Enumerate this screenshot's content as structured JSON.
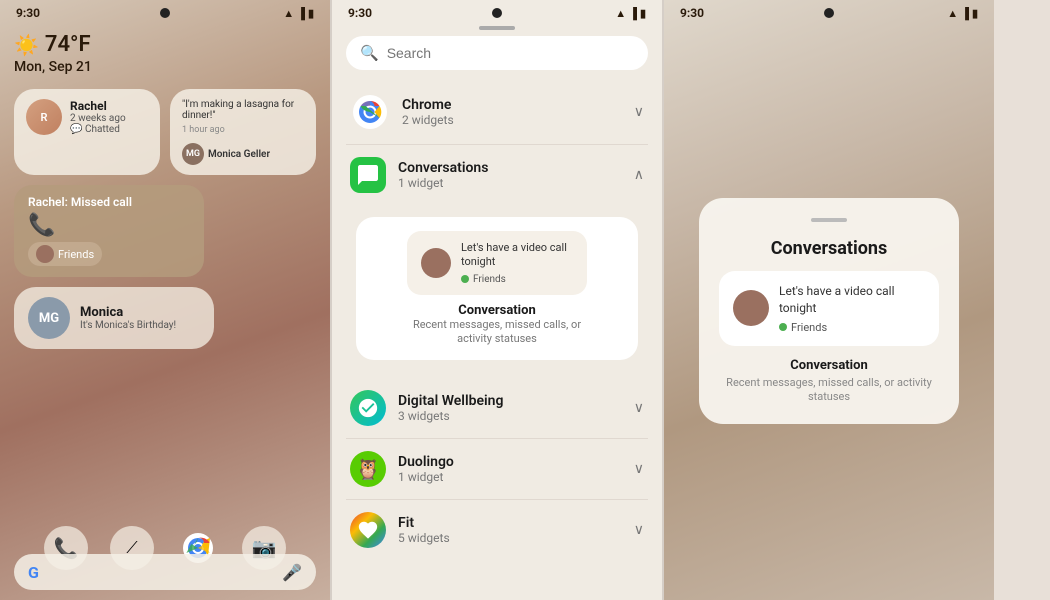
{
  "phone1": {
    "status_bar": {
      "time": "9:30"
    },
    "weather": {
      "temp": "74°F",
      "icon": "☀️",
      "date": "Mon, Sep 21"
    },
    "rachel_card": {
      "name": "Rachel",
      "sub": "2 weeks ago",
      "action": "Chatted"
    },
    "message_card": {
      "text": "\"I'm making a lasagna for dinner!\"",
      "time": "1 hour ago",
      "sender": "Monica Geller"
    },
    "missed_call": {
      "label": "Rachel: Missed call",
      "group": "Friends"
    },
    "monica_card": {
      "initials": "MG",
      "name": "Monica",
      "sub": "It's Monica's Birthday!"
    },
    "google_bar": {
      "g": "G"
    }
  },
  "phone2": {
    "status_bar": {
      "time": "9:30"
    },
    "search_placeholder": "Search",
    "apps": [
      {
        "name": "Chrome",
        "count": "2 widgets",
        "expanded": false
      },
      {
        "name": "Conversations",
        "count": "1 widget",
        "expanded": true
      },
      {
        "name": "Digital Wellbeing",
        "count": "3 widgets",
        "expanded": false
      },
      {
        "name": "Duolingo",
        "count": "1 widget",
        "expanded": false
      },
      {
        "name": "Fit",
        "count": "5 widgets",
        "expanded": false
      }
    ],
    "widget_preview": {
      "bubble_text": "Let's have a video call tonight",
      "badge_label": "Friends",
      "title": "Conversation",
      "desc": "Recent messages, missed calls, or activity statuses"
    }
  },
  "phone3": {
    "status_bar": {
      "time": "9:30"
    },
    "card": {
      "title": "Conversations",
      "bubble_text": "Let's have a video call tonight",
      "badge_label": "Friends",
      "label": "Conversation",
      "desc": "Recent messages, missed calls, or activity statuses"
    }
  }
}
